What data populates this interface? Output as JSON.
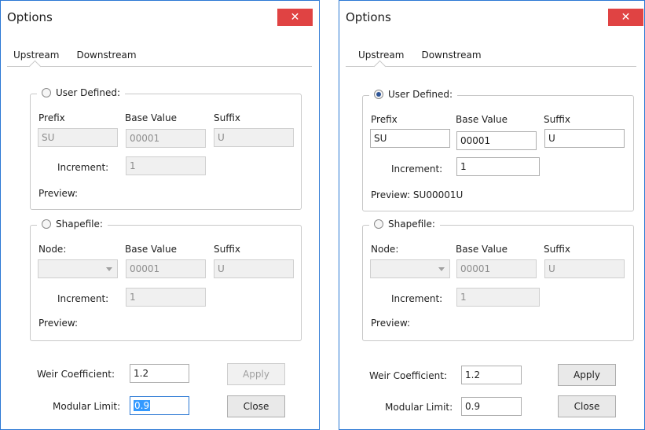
{
  "left": {
    "title": "Options",
    "close_icon": "close-icon",
    "tabs": [
      "Upstream",
      "Downstream"
    ],
    "user_defined": {
      "label": "User Defined:",
      "selected": false,
      "prefix_label": "Prefix",
      "base_label": "Base Value",
      "suffix_label": "Suffix",
      "prefix_value": "SU",
      "base_value": "00001",
      "suffix_value": "U",
      "increment_label": "Increment:",
      "increment_value": "1",
      "preview": "Preview:"
    },
    "shapefile": {
      "label": "Shapefile:",
      "selected": false,
      "node_label": "Node:",
      "base_label": "Base Value",
      "suffix_label": "Suffix",
      "node_value": "",
      "base_value": "00001",
      "suffix_value": "U",
      "increment_label": "Increment:",
      "increment_value": "1",
      "preview": "Preview:"
    },
    "weir_label": "Weir Coefficient:",
    "weir_value": "1.2",
    "modular_label": "Modular Limit:",
    "modular_value": "0.9",
    "apply": "Apply",
    "close": "Close"
  },
  "right": {
    "title": "Options",
    "close_icon": "close-icon",
    "tabs": [
      "Upstream",
      "Downstream"
    ],
    "user_defined": {
      "label": "User Defined:",
      "selected": true,
      "prefix_label": "Prefix",
      "base_label": "Base Value",
      "suffix_label": "Suffix",
      "prefix_value": "SU",
      "base_value": "00001",
      "suffix_value": "U",
      "increment_label": "Increment:",
      "increment_value": "1",
      "preview": "Preview: SU00001U"
    },
    "shapefile": {
      "label": "Shapefile:",
      "selected": false,
      "node_label": "Node:",
      "base_label": "Base Value",
      "suffix_label": "Suffix",
      "node_value": "",
      "base_value": "00001",
      "suffix_value": "U",
      "increment_label": "Increment:",
      "increment_value": "1",
      "preview": "Preview:"
    },
    "weir_label": "Weir Coefficient:",
    "weir_value": "1.2",
    "modular_label": "Modular Limit:",
    "modular_value": "0.9",
    "apply": "Apply",
    "close": "Close"
  },
  "colors": {
    "accent": "#2b78d4",
    "close_button": "#e04343",
    "selection": "#3399ff"
  }
}
